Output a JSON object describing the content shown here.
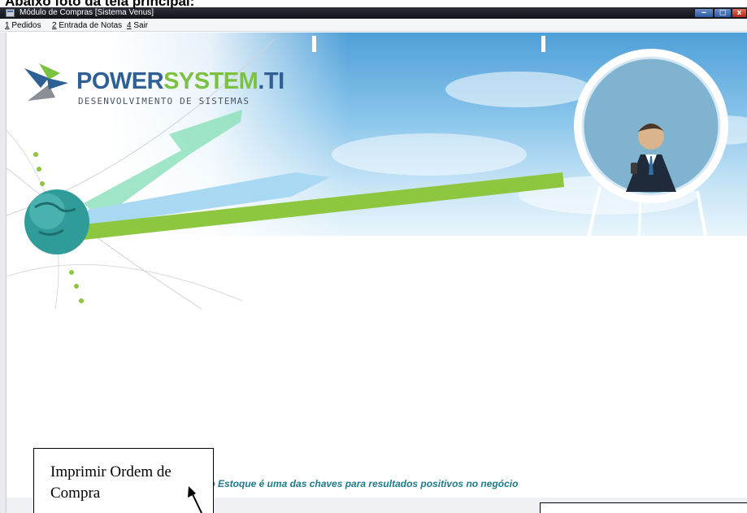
{
  "document": {
    "heading": "Abaixo foto da tela principal:"
  },
  "window": {
    "title": "Módulo de Compras [Sistema Venus]",
    "controls": {
      "minimize": "‒",
      "maximize": "□",
      "close": "x"
    }
  },
  "menubar": {
    "items": [
      {
        "accel": "1",
        "label": " Pedidos"
      },
      {
        "accel": "2",
        "label": " Entrada de Notas"
      },
      {
        "accel": "4",
        "label": " Sair"
      }
    ]
  },
  "banner": {
    "logo_part1": "POWER",
    "logo_part2": "SYSTEM",
    "logo_part3": ".TI",
    "logo_subtitle": "DESENVOLVIMENTO DE SISTEMAS"
  },
  "main": {
    "slogan": "lo Estoque é uma das chaves para resultados positivos no negócio"
  },
  "annotation": {
    "callout_text": "Imprimir Ordem de Compra"
  },
  "colors": {
    "logo_blue": "#2e5f95",
    "logo_green": "#7cc242",
    "slogan": "#1f7a8a",
    "sky": "#86c3ea"
  }
}
